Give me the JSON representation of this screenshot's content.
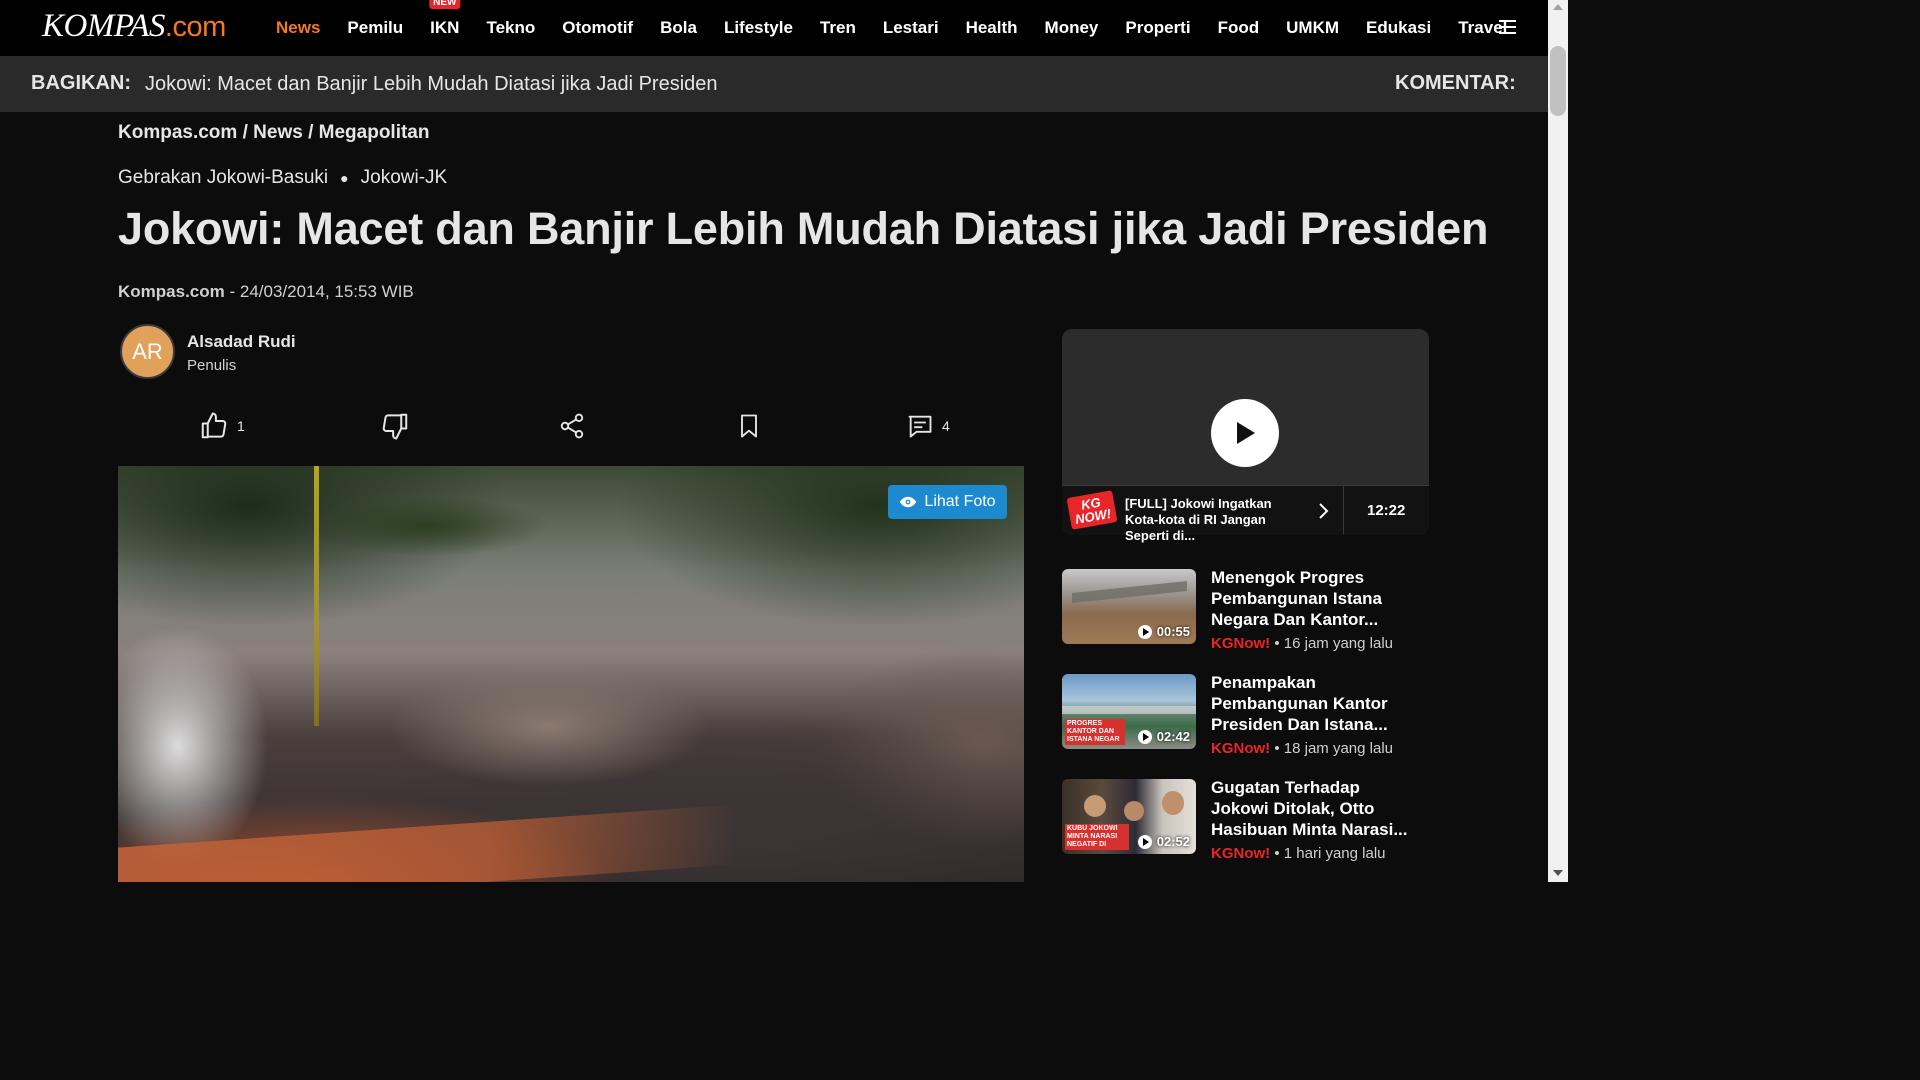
{
  "logo": {
    "main": "KOMPAS",
    "suffix": ".com"
  },
  "nav": {
    "items": [
      {
        "label": "News",
        "active": true
      },
      {
        "label": "Pemilu"
      },
      {
        "label": "IKN",
        "badge": "NEW"
      },
      {
        "label": "Tekno"
      },
      {
        "label": "Otomotif"
      },
      {
        "label": "Bola"
      },
      {
        "label": "Lifestyle"
      },
      {
        "label": "Tren"
      },
      {
        "label": "Lestari"
      },
      {
        "label": "Health"
      },
      {
        "label": "Money"
      },
      {
        "label": "Properti"
      },
      {
        "label": "Food"
      },
      {
        "label": "UMKM"
      },
      {
        "label": "Edukasi"
      },
      {
        "label": "Travel"
      }
    ]
  },
  "sharebar": {
    "share_label": "BAGIKAN:",
    "title": "Jokowi: Macet dan Banjir Lebih Mudah Diatasi jika Jadi Presiden",
    "comment_label": "KOMENTAR:"
  },
  "article": {
    "breadcrumb": [
      "Kompas.com",
      "News",
      "Megapolitan"
    ],
    "tags": [
      "Gebrakan Jokowi-Basuki",
      "Jokowi-JK"
    ],
    "headline": "Jokowi: Macet dan Banjir Lebih Mudah Diatasi jika Jadi Presiden",
    "source": "Kompas.com",
    "datetime": "- 24/03/2014, 15:53 WIB",
    "author": {
      "initials": "AR",
      "name": "Alsadad Rudi",
      "role": "Penulis"
    },
    "actions": {
      "like_count": "1",
      "comment_count": "4"
    },
    "photo_button": "Lihat Foto"
  },
  "sidebar": {
    "video": {
      "brand_top": "KG",
      "brand_bottom": "NOW!",
      "title": "[FULL] Jokowi Ingatkan Kota-kota di RI Jangan Seperti di...",
      "duration": "12:22"
    },
    "items": [
      {
        "title": "Menengok Progres Pembangunan Istana Negara Dan Kantor...",
        "duration": "00:55",
        "brand": "KGNow!",
        "time": "• 16 jam yang lalu"
      },
      {
        "title": "Penampakan Pembangunan Kantor Presiden Dan Istana...",
        "duration": "02:42",
        "brand": "KGNow!",
        "time": "• 18 jam yang lalu",
        "caption": "PROGRES KANTOR DAN ISTANA NEGAR"
      },
      {
        "title": "Gugatan Terhadap Jokowi Ditolak, Otto Hasibuan Minta Narasi...",
        "duration": "02:52",
        "brand": "KGNow!",
        "time": "• 1 hari yang lalu",
        "caption": "KUBU JOKOWI MINTA NARASI NEGATIF DI"
      }
    ]
  },
  "colors": {
    "accent": "#f47920",
    "kgnow_red": "#e8262a",
    "photo_button": "#1d8ad0"
  }
}
